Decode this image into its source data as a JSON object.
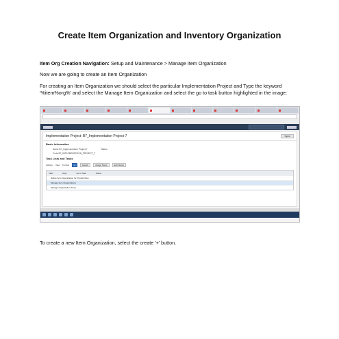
{
  "document": {
    "title": "Create Item Organization and Inventory Organization",
    "nav_label": "Item Org Creation Navigation:",
    "nav_value": " Setup and Maintenance > Manage Item Organization",
    "intro": "Now we are going to create an Item Organization",
    "instructions": "For creating an Item Organization we should select the particular Implementation Project and Type the keyword '%item%org%' and select the Manage Item Organization and select the go to task button highlighted in the image:",
    "footer_text": "To create a new Item Organization, select the create '+' button."
  },
  "screenshot": {
    "page_header": "Implementation Project: B7_Implementation Project-7",
    "open_label": "Open",
    "basic_info": "Basic Information",
    "name_line": "Name  B7_Implementation Project-7",
    "status_line": "Status",
    "code_line": "Code  B7_IMPLEMENTATION_PROJECT_7",
    "task_lists": "Task Lists and Tasks",
    "toolbar_actions": "Actions",
    "toolbar_view": "View",
    "toolbar_format": "Format",
    "toolbar_plus": "+",
    "toolbar_detach": "Detach",
    "toolbar_assign": "Assign Tasks",
    "toolbar_edit": "Edit Status",
    "col_task": "Task",
    "col_help": "Help",
    "col_goto": "Go to Task",
    "col_status": "Status",
    "row1": "Define Item Organization for Product Man",
    "row2": "Manage Item Organizations",
    "row3": "Manage Organization Trees"
  }
}
